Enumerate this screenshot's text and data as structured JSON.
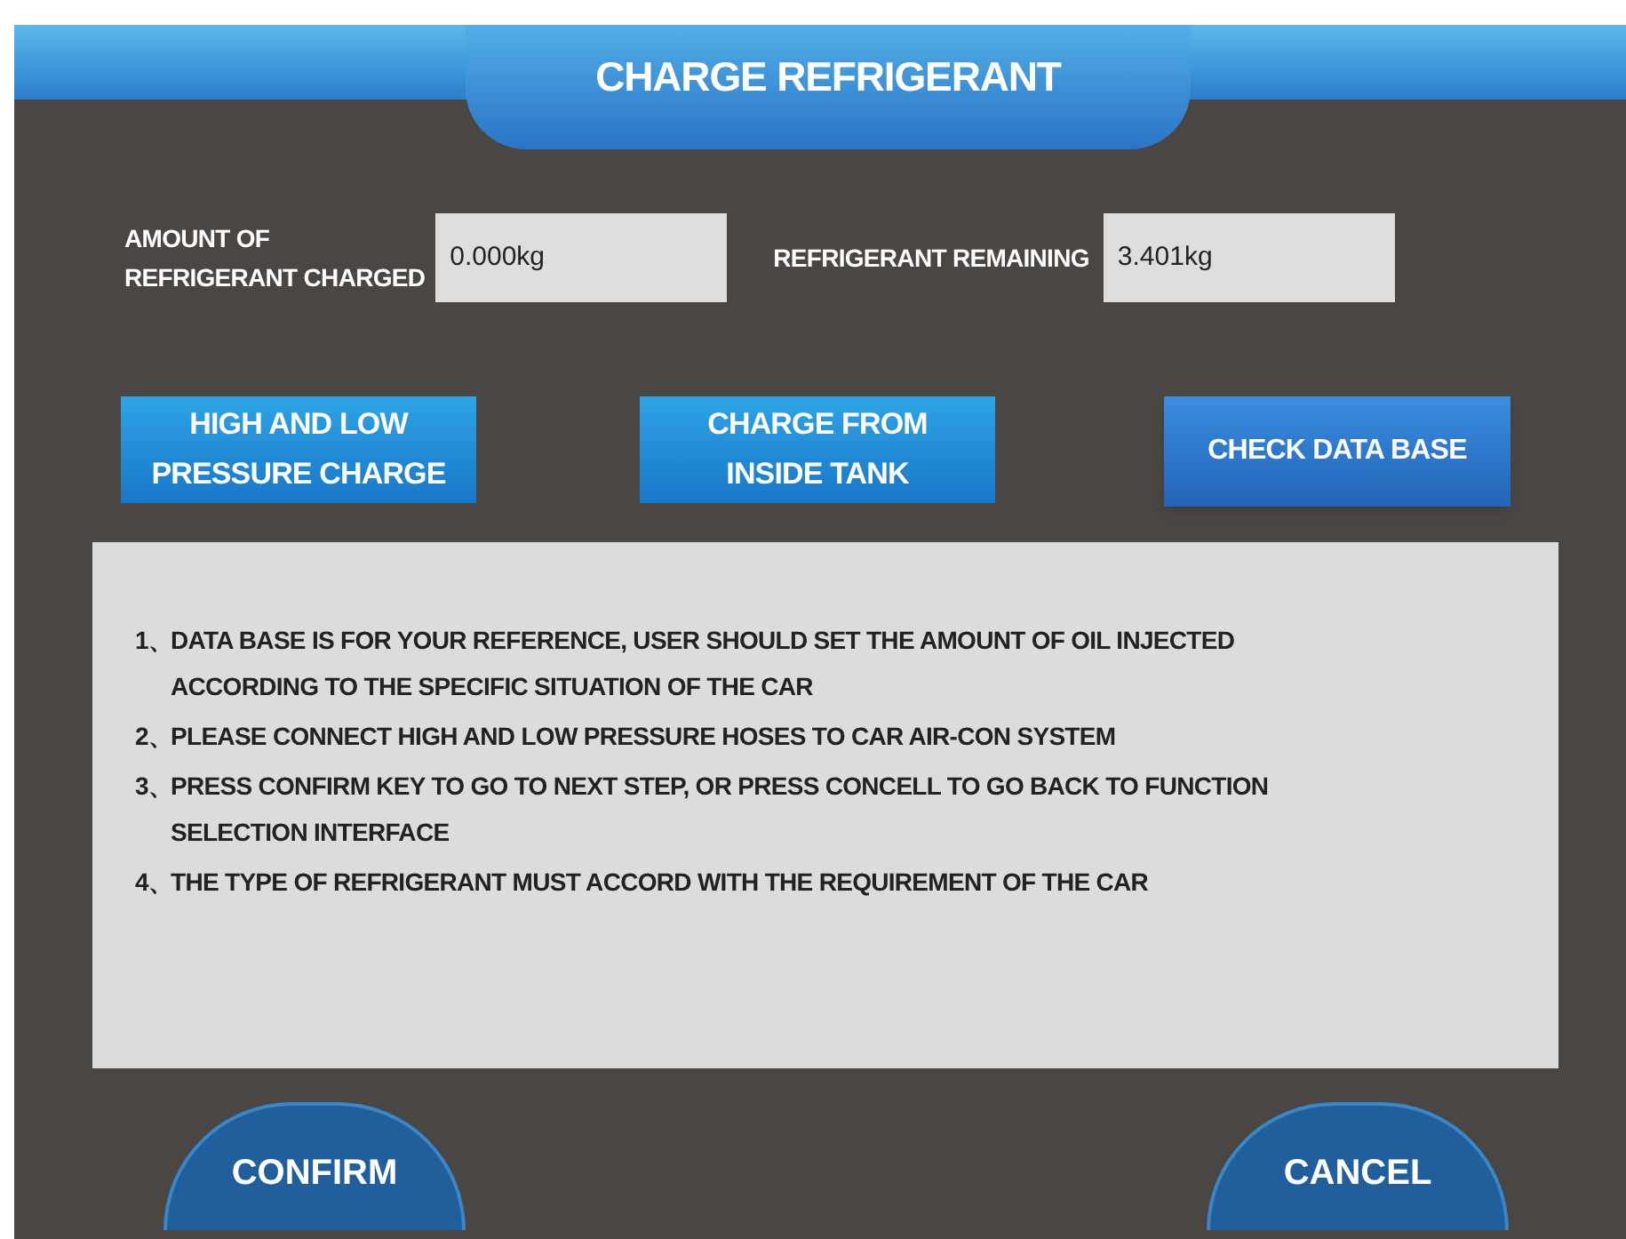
{
  "window": {
    "title": "CHARGE REFRIGERANT"
  },
  "fields": [
    {
      "label": "AMOUNT OF\nREFRIGERANT CHARGED",
      "value": "0.000kg"
    },
    {
      "label": "REFRIGERANT REMAINING",
      "value": "3.401kg"
    }
  ],
  "mode_buttons": [
    {
      "label": "HIGH AND LOW\nPRESSURE CHARGE",
      "kind": "mode"
    },
    {
      "label": "CHARGE FROM\nINSIDE TANK",
      "kind": "mode"
    },
    {
      "label": "CHECK DATA BASE",
      "kind": "action"
    }
  ],
  "notes": [
    {
      "number": "1、",
      "text": "DATA BASE IS FOR YOUR REFERENCE, USER SHOULD SET THE AMOUNT OF OIL INJECTED ACCORDING TO THE SPECIFIC SITUATION OF THE CAR"
    },
    {
      "number": "2、",
      "text": "PLEASE CONNECT HIGH AND LOW PRESSURE HOSES TO CAR AIR-CON SYSTEM"
    },
    {
      "number": "3、",
      "text": "PRESS CONFIRM KEY TO GO TO NEXT STEP, OR PRESS CONCELL TO GO BACK TO FUNCTION SELECTION INTERFACE"
    },
    {
      "number": "4、",
      "text": "THE TYPE OF REFRIGERANT MUST ACCORD WITH THE REQUIREMENT OF THE CAR"
    }
  ],
  "footer_buttons": [
    "CONFIRM",
    "CANCEL"
  ]
}
